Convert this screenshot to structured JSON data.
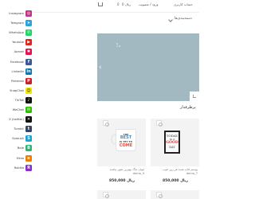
{
  "header": {
    "account_label": "حساب کاربری",
    "register_label": "ورود / عضویت",
    "cart_count": "0",
    "cart_total": "0 ریال",
    "signin_label": "ورود"
  },
  "subnav": {
    "label": "دسته‌بندی‌ها"
  },
  "section": {
    "title": "پرطرفدار"
  },
  "products": [
    {
      "name": "پوستر قاب شده هر روز خوب",
      "code": "demo_7",
      "price": "850,000 ریال",
      "image": {
        "line1": "TODAY",
        "line2": "IS A",
        "line3": "GOOD",
        "line4": "DAY"
      }
    },
    {
      "name": "لیوان ماگ بهترین هنوز نیامده",
      "code": "demo_9",
      "price": "850,000 ریال",
      "image": {
        "line1": "THE",
        "line2": "BEST",
        "line3": "IS YET TO",
        "line4": "COME"
      }
    }
  ],
  "social": [
    {
      "label": "Instagram",
      "icon": "instagram-icon",
      "glyph": "◎",
      "color": "#c13584"
    },
    {
      "label": "Telegram",
      "icon": "telegram-icon",
      "glyph": "➤",
      "color": "#2aa3df"
    },
    {
      "label": "WhatsApp",
      "icon": "whatsapp-icon",
      "glyph": "✆",
      "color": "#25d366"
    },
    {
      "label": "Youtube",
      "icon": "youtube-icon",
      "glyph": "▶",
      "color": "#e62117"
    },
    {
      "label": "Aparat",
      "icon": "aparat-icon",
      "glyph": "✱",
      "color": "#e0124f"
    },
    {
      "label": "Facebook",
      "icon": "facebook-icon",
      "glyph": "f",
      "color": "#3b5998"
    },
    {
      "label": "LinkedIn",
      "icon": "linkedin-icon",
      "glyph": "in",
      "color": "#0a78b5"
    },
    {
      "label": "Pinterest",
      "icon": "pinterest-icon",
      "glyph": "P",
      "color": "#cb2027"
    },
    {
      "label": "SnapChat",
      "icon": "snapchat-icon",
      "glyph": "☺",
      "color": "#f7e600"
    },
    {
      "label": "TikTok",
      "icon": "tiktok-icon",
      "glyph": "♪",
      "color": "#111111"
    },
    {
      "label": "WeChat",
      "icon": "wechat-icon",
      "glyph": "✉",
      "color": "#2dc100"
    },
    {
      "label": "X (twitter)",
      "icon": "x-twitter-icon",
      "glyph": "✕",
      "color": "#111111"
    },
    {
      "label": "Tumblr",
      "icon": "tumblr-icon",
      "glyph": "t",
      "color": "#36465d"
    },
    {
      "label": "Soroush",
      "icon": "soroush-icon",
      "glyph": "S",
      "color": "#1fa2d6"
    },
    {
      "label": "Bale",
      "icon": "bale-icon",
      "glyph": "B",
      "color": "#2bb673"
    },
    {
      "label": "Eitaa",
      "icon": "eitaa-icon",
      "glyph": "e",
      "color": "#ef7d00"
    },
    {
      "label": "Rubika",
      "icon": "rubika-icon",
      "glyph": "R",
      "color": "#8b2ec9"
    }
  ]
}
